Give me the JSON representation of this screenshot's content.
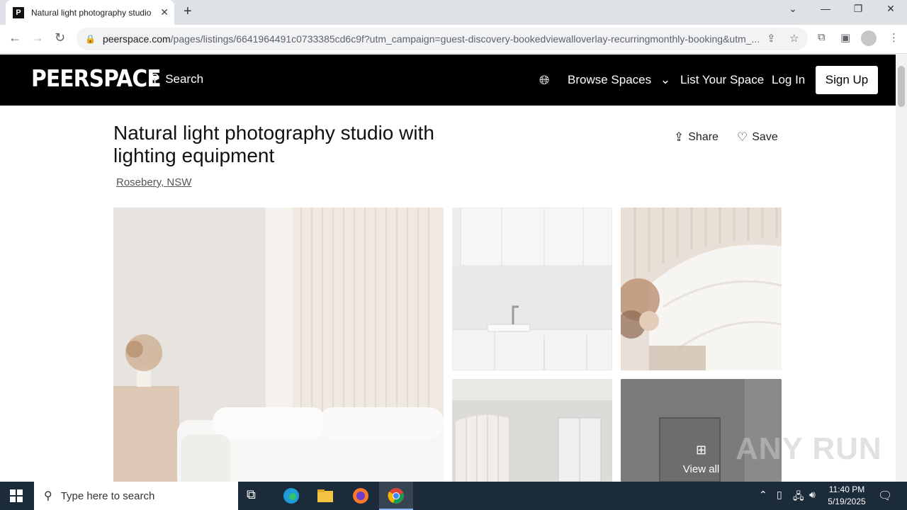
{
  "browser": {
    "tab_title": "Natural light photography studio with lighting equipment",
    "new_tab": "+",
    "url_domain": "peerspace.com",
    "url_path": "/pages/listings/6641964491c0733385cd6c9f?utm_campaign=guest-discovery-bookedviewalloverlay-recurringmonthly-booking&utm_..."
  },
  "header": {
    "logo": "PEERSPACE",
    "search_label": "Search",
    "browse_label": "Browse Spaces",
    "list_label": "List Your Space",
    "login_label": "Log In",
    "signup_label": "Sign Up"
  },
  "listing": {
    "title": "Natural light photography studio with lighting equipment",
    "location": "Rosebery, NSW",
    "share_label": "Share",
    "save_label": "Save",
    "view_all_label": "View all"
  },
  "watermark": "ANY RUN",
  "taskbar": {
    "search_placeholder": "Type here to search",
    "time": "11:40 PM",
    "date": "5/19/2025"
  }
}
